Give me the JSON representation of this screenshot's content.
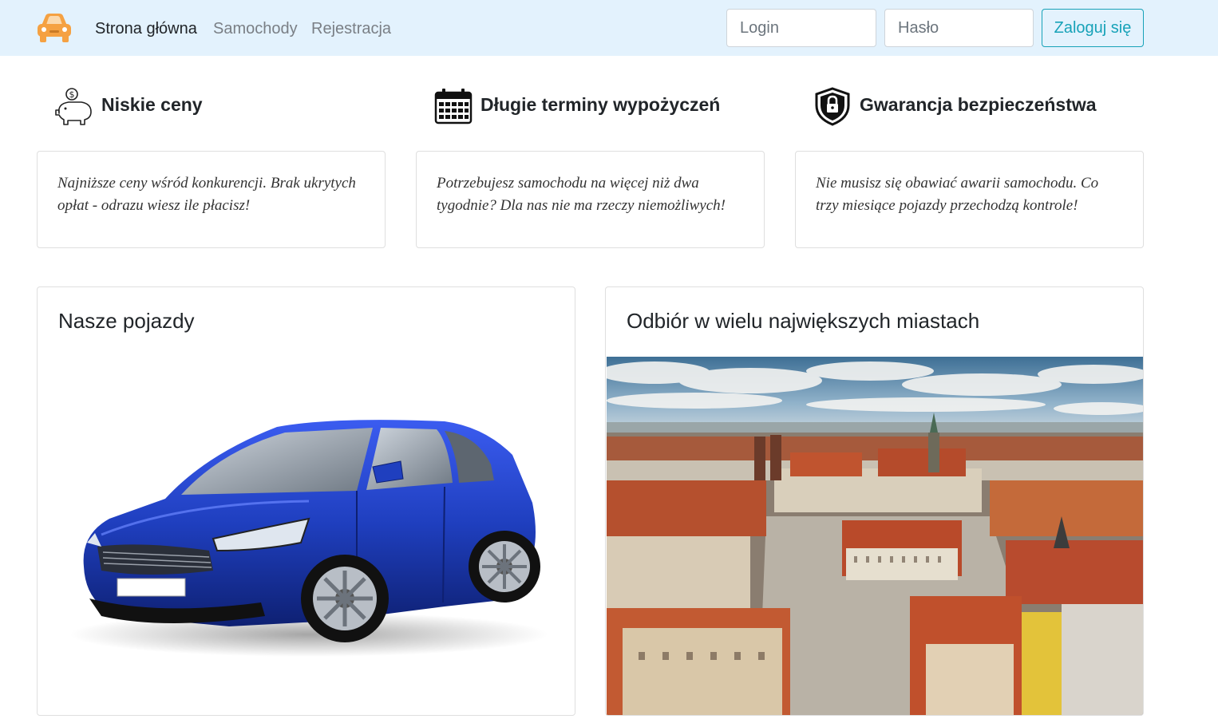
{
  "nav": {
    "logo_icon": "car-icon",
    "links": [
      {
        "label": "Strona główna",
        "active": true
      },
      {
        "label": "Samochody",
        "active": false
      },
      {
        "label": "Rejestracja",
        "active": false
      }
    ],
    "login_placeholder": "Login",
    "password_placeholder": "Hasło",
    "login_button": "Zaloguj się"
  },
  "features": [
    {
      "icon": "piggy-bank-icon",
      "title": "Niskie ceny",
      "text": "Najniższe ceny wśród konkurencji. Brak ukrytych opłat - odrazu wiesz ile płacisz!"
    },
    {
      "icon": "calendar-icon",
      "title": "Długie terminy wypożyczeń",
      "text": "Potrzebujesz samochodu na więcej niż dwa tygodnie? Dla nas nie ma rzeczy niemożliwych!"
    },
    {
      "icon": "shield-lock-icon",
      "title": "Gwarancja bezpieczeństwa",
      "text": "Nie musisz się obawiać awarii samochodu. Co trzy miesiące pojazdy przechodzą kontrole!"
    }
  ],
  "cards": [
    {
      "title": "Nasze pojazdy",
      "image": "blue-car-image"
    },
    {
      "title": "Odbiór w wielu największych miastach",
      "image": "city-aerial-image"
    }
  ],
  "colors": {
    "navbar_bg": "#e3f2fd",
    "accent": "#17a2b8",
    "logo": "#f5a142",
    "car_blue": "#1f3fbf"
  }
}
